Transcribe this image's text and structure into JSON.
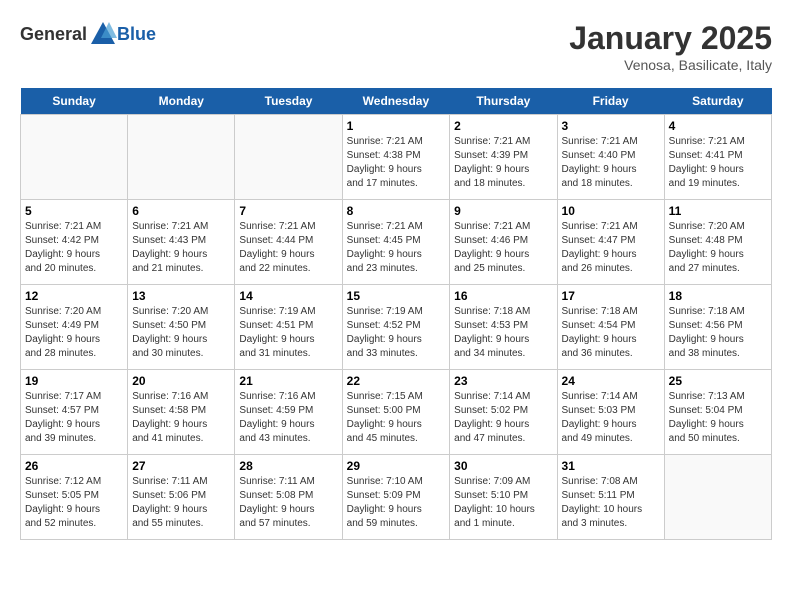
{
  "header": {
    "logo_general": "General",
    "logo_blue": "Blue",
    "title": "January 2025",
    "subtitle": "Venosa, Basilicate, Italy"
  },
  "days_of_week": [
    "Sunday",
    "Monday",
    "Tuesday",
    "Wednesday",
    "Thursday",
    "Friday",
    "Saturday"
  ],
  "weeks": [
    [
      {
        "date": "",
        "info": ""
      },
      {
        "date": "",
        "info": ""
      },
      {
        "date": "",
        "info": ""
      },
      {
        "date": "1",
        "info": "Sunrise: 7:21 AM\nSunset: 4:38 PM\nDaylight: 9 hours\nand 17 minutes."
      },
      {
        "date": "2",
        "info": "Sunrise: 7:21 AM\nSunset: 4:39 PM\nDaylight: 9 hours\nand 18 minutes."
      },
      {
        "date": "3",
        "info": "Sunrise: 7:21 AM\nSunset: 4:40 PM\nDaylight: 9 hours\nand 18 minutes."
      },
      {
        "date": "4",
        "info": "Sunrise: 7:21 AM\nSunset: 4:41 PM\nDaylight: 9 hours\nand 19 minutes."
      }
    ],
    [
      {
        "date": "5",
        "info": "Sunrise: 7:21 AM\nSunset: 4:42 PM\nDaylight: 9 hours\nand 20 minutes."
      },
      {
        "date": "6",
        "info": "Sunrise: 7:21 AM\nSunset: 4:43 PM\nDaylight: 9 hours\nand 21 minutes."
      },
      {
        "date": "7",
        "info": "Sunrise: 7:21 AM\nSunset: 4:44 PM\nDaylight: 9 hours\nand 22 minutes."
      },
      {
        "date": "8",
        "info": "Sunrise: 7:21 AM\nSunset: 4:45 PM\nDaylight: 9 hours\nand 23 minutes."
      },
      {
        "date": "9",
        "info": "Sunrise: 7:21 AM\nSunset: 4:46 PM\nDaylight: 9 hours\nand 25 minutes."
      },
      {
        "date": "10",
        "info": "Sunrise: 7:21 AM\nSunset: 4:47 PM\nDaylight: 9 hours\nand 26 minutes."
      },
      {
        "date": "11",
        "info": "Sunrise: 7:20 AM\nSunset: 4:48 PM\nDaylight: 9 hours\nand 27 minutes."
      }
    ],
    [
      {
        "date": "12",
        "info": "Sunrise: 7:20 AM\nSunset: 4:49 PM\nDaylight: 9 hours\nand 28 minutes."
      },
      {
        "date": "13",
        "info": "Sunrise: 7:20 AM\nSunset: 4:50 PM\nDaylight: 9 hours\nand 30 minutes."
      },
      {
        "date": "14",
        "info": "Sunrise: 7:19 AM\nSunset: 4:51 PM\nDaylight: 9 hours\nand 31 minutes."
      },
      {
        "date": "15",
        "info": "Sunrise: 7:19 AM\nSunset: 4:52 PM\nDaylight: 9 hours\nand 33 minutes."
      },
      {
        "date": "16",
        "info": "Sunrise: 7:18 AM\nSunset: 4:53 PM\nDaylight: 9 hours\nand 34 minutes."
      },
      {
        "date": "17",
        "info": "Sunrise: 7:18 AM\nSunset: 4:54 PM\nDaylight: 9 hours\nand 36 minutes."
      },
      {
        "date": "18",
        "info": "Sunrise: 7:18 AM\nSunset: 4:56 PM\nDaylight: 9 hours\nand 38 minutes."
      }
    ],
    [
      {
        "date": "19",
        "info": "Sunrise: 7:17 AM\nSunset: 4:57 PM\nDaylight: 9 hours\nand 39 minutes."
      },
      {
        "date": "20",
        "info": "Sunrise: 7:16 AM\nSunset: 4:58 PM\nDaylight: 9 hours\nand 41 minutes."
      },
      {
        "date": "21",
        "info": "Sunrise: 7:16 AM\nSunset: 4:59 PM\nDaylight: 9 hours\nand 43 minutes."
      },
      {
        "date": "22",
        "info": "Sunrise: 7:15 AM\nSunset: 5:00 PM\nDaylight: 9 hours\nand 45 minutes."
      },
      {
        "date": "23",
        "info": "Sunrise: 7:14 AM\nSunset: 5:02 PM\nDaylight: 9 hours\nand 47 minutes."
      },
      {
        "date": "24",
        "info": "Sunrise: 7:14 AM\nSunset: 5:03 PM\nDaylight: 9 hours\nand 49 minutes."
      },
      {
        "date": "25",
        "info": "Sunrise: 7:13 AM\nSunset: 5:04 PM\nDaylight: 9 hours\nand 50 minutes."
      }
    ],
    [
      {
        "date": "26",
        "info": "Sunrise: 7:12 AM\nSunset: 5:05 PM\nDaylight: 9 hours\nand 52 minutes."
      },
      {
        "date": "27",
        "info": "Sunrise: 7:11 AM\nSunset: 5:06 PM\nDaylight: 9 hours\nand 55 minutes."
      },
      {
        "date": "28",
        "info": "Sunrise: 7:11 AM\nSunset: 5:08 PM\nDaylight: 9 hours\nand 57 minutes."
      },
      {
        "date": "29",
        "info": "Sunrise: 7:10 AM\nSunset: 5:09 PM\nDaylight: 9 hours\nand 59 minutes."
      },
      {
        "date": "30",
        "info": "Sunrise: 7:09 AM\nSunset: 5:10 PM\nDaylight: 10 hours\nand 1 minute."
      },
      {
        "date": "31",
        "info": "Sunrise: 7:08 AM\nSunset: 5:11 PM\nDaylight: 10 hours\nand 3 minutes."
      },
      {
        "date": "",
        "info": ""
      }
    ]
  ]
}
